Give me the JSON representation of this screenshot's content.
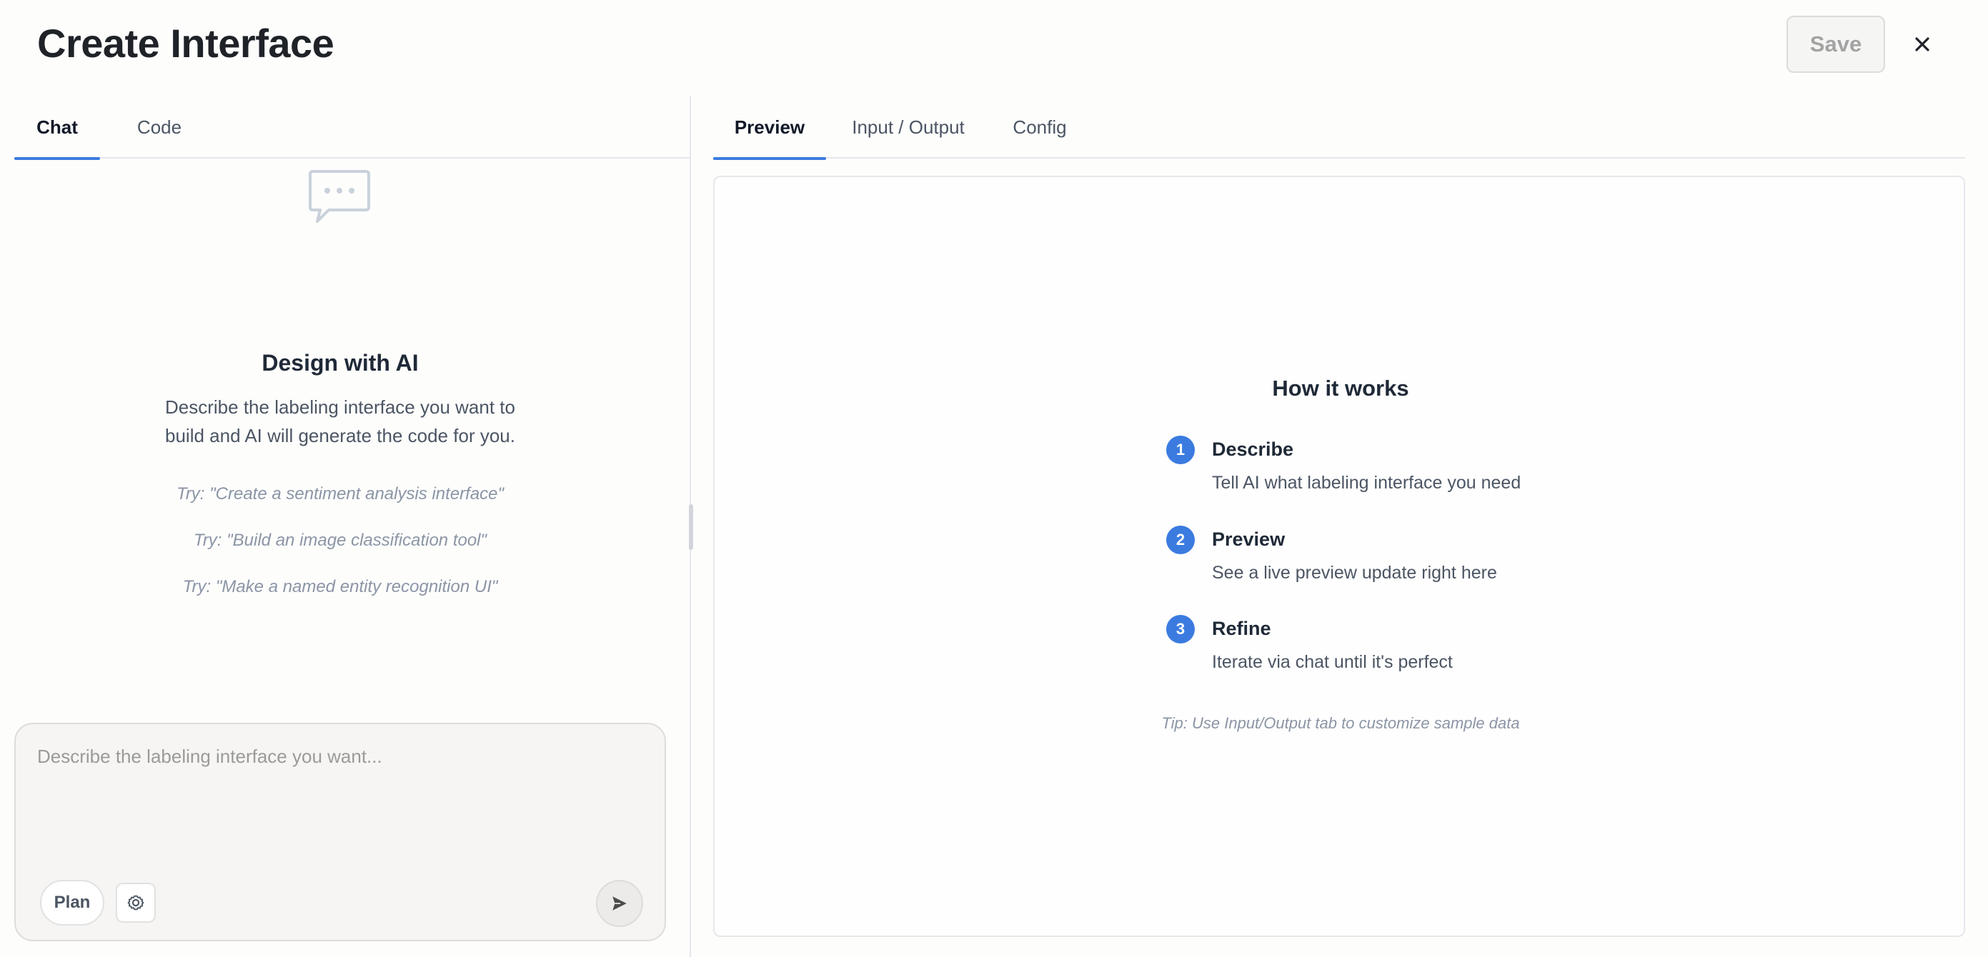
{
  "header": {
    "title": "Create Interface",
    "save_label": "Save",
    "close_glyph": "×"
  },
  "left_tabs": [
    {
      "label": "Chat",
      "active": true
    },
    {
      "label": "Code",
      "active": false
    }
  ],
  "empty_state": {
    "icon": "chat-bubble-icon",
    "title": "Design with AI",
    "description": "Describe the labeling interface you want to build and AI will generate the code for you.",
    "suggestions": [
      "Try: \"Create a sentiment analysis interface\"",
      "Try: \"Build an image classification tool\"",
      "Try: \"Make a named entity recognition UI\""
    ]
  },
  "chat_input": {
    "placeholder": "Describe the labeling interface you want...",
    "value": "",
    "plan_label": "Plan",
    "settings_icon": "gear-icon",
    "send_icon": "send-icon"
  },
  "right_tabs": [
    {
      "label": "Preview",
      "active": true
    },
    {
      "label": "Input / Output",
      "active": false
    },
    {
      "label": "Config",
      "active": false
    }
  ],
  "how_it_works": {
    "title": "How it works",
    "steps": [
      {
        "number": "1",
        "title": "Describe",
        "description": "Tell AI what labeling interface you need"
      },
      {
        "number": "2",
        "title": "Preview",
        "description": "See a live preview update right here"
      },
      {
        "number": "3",
        "title": "Refine",
        "description": "Iterate via chat until it's perfect"
      }
    ],
    "tip": "Tip: Use Input/Output tab to customize sample data"
  },
  "colors": {
    "accent": "#3b7be0",
    "background": "#fdfdfc",
    "muted_text": "#8b95a5"
  }
}
